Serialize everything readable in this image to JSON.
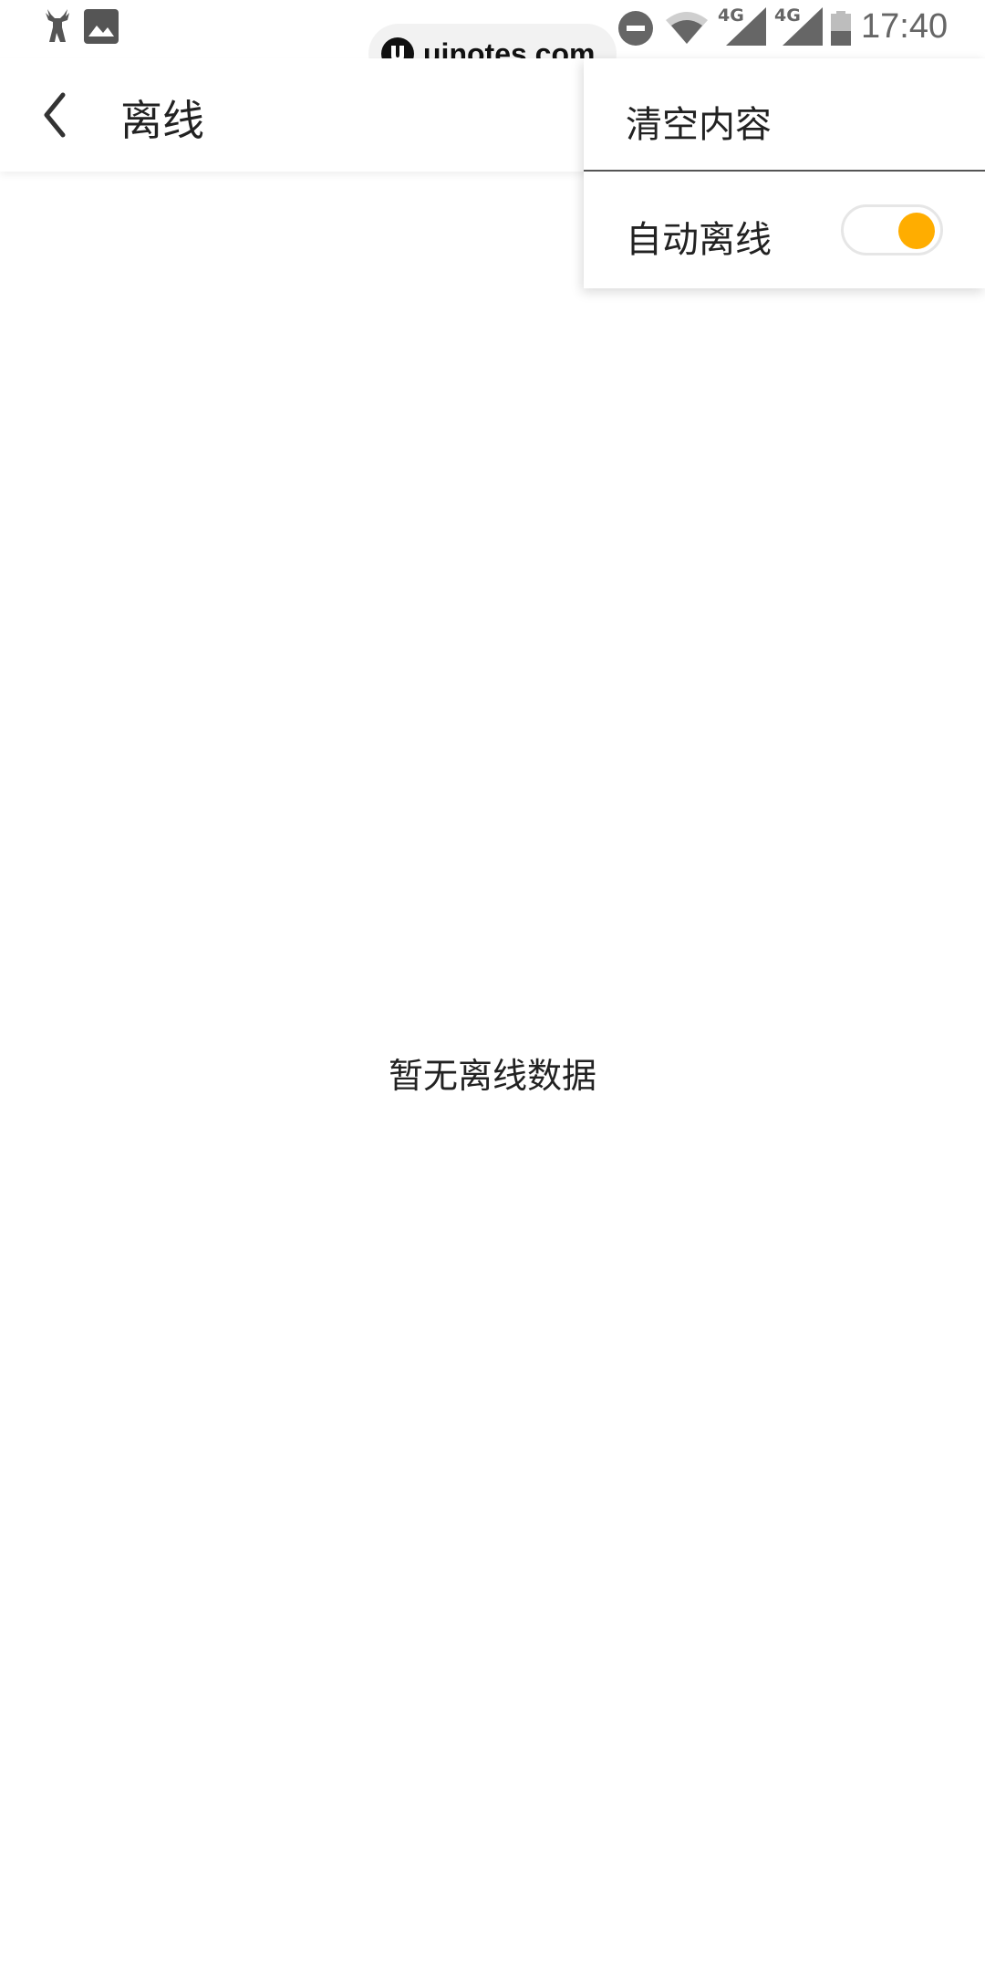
{
  "status_bar": {
    "time": "17:40",
    "network_1": "4G",
    "network_2": "4G",
    "icons": [
      "deer-icon",
      "image-icon",
      "do-not-disturb-icon",
      "wifi-icon",
      "signal-icon",
      "signal-icon",
      "battery-icon"
    ]
  },
  "watermark": {
    "text": "uinotes.com"
  },
  "app_bar": {
    "title": "离线",
    "back_icon": "chevron-left-icon"
  },
  "empty_state": {
    "message": "暂无离线数据"
  },
  "menu": {
    "clear_label": "清空内容",
    "auto_offline_label": "自动离线",
    "auto_offline_enabled": true
  },
  "colors": {
    "accent": "#ffad00",
    "text": "#222222",
    "status_icons": "#666666"
  }
}
